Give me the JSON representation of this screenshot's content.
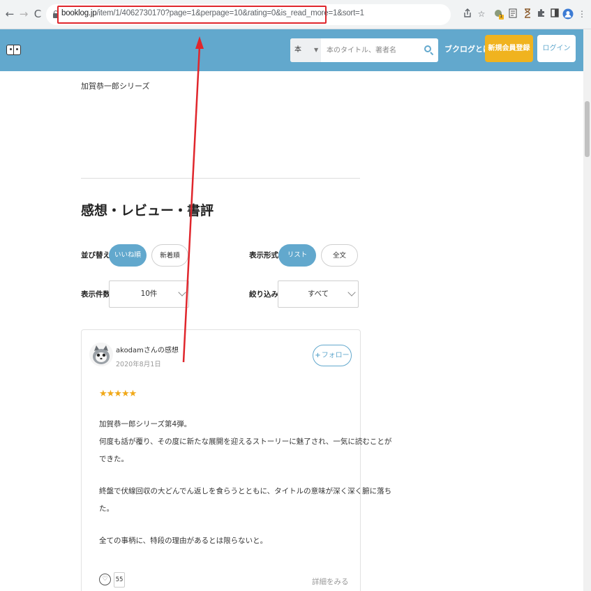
{
  "browser": {
    "back_icon": "←",
    "forward_icon": "→",
    "reload_icon": "C",
    "url_host": "booklog.jp",
    "url_path": "/item/1/4062730170?page=1&perpage=10&rating=0&is_read_more=1&sort=1",
    "extension_badge": "1"
  },
  "header": {
    "search_category": "本",
    "search_placeholder": "本のタイトル、著者名",
    "about_label": "ブクログとは",
    "signup_label": "新規会員登録",
    "login_label": "ログイン"
  },
  "content": {
    "series_label": "加賀恭一郎シリーズ",
    "section_title": "感想・レビュー・書評",
    "sort_label": "並び替え",
    "sort_options": [
      "いいね順",
      "新着順"
    ],
    "display_label": "表示形式",
    "display_options": [
      "リスト",
      "全文"
    ],
    "count_label": "表示件数",
    "count_value": "10件",
    "filter_label": "絞り込み",
    "filter_value": "すべて"
  },
  "review": {
    "reviewer": "akodamさんの感想",
    "date": "2020年8月1日",
    "follow_label": "フォロー",
    "stars": "★★★★★",
    "rating": 5,
    "lines": [
      "加賀恭一郎シリーズ第4弾。",
      "何度も話が覆り、その度に新たな展開を迎えるストーリーに魅了され、一気に読むことが",
      "できた。",
      "終盤で伏線回収の大どんでん返しを食らうとともに、タイトルの意味が深く深く腑に落ち",
      "た。",
      "全ての事柄に、特段の理由があるとは限らないと。"
    ],
    "likes": "55",
    "detail_label": "詳細をみる"
  },
  "colors": {
    "brand_blue": "#62a8cd",
    "signup_yellow": "#f0b31f",
    "annotation_red": "#e0262c",
    "star_orange": "#f0a818"
  }
}
